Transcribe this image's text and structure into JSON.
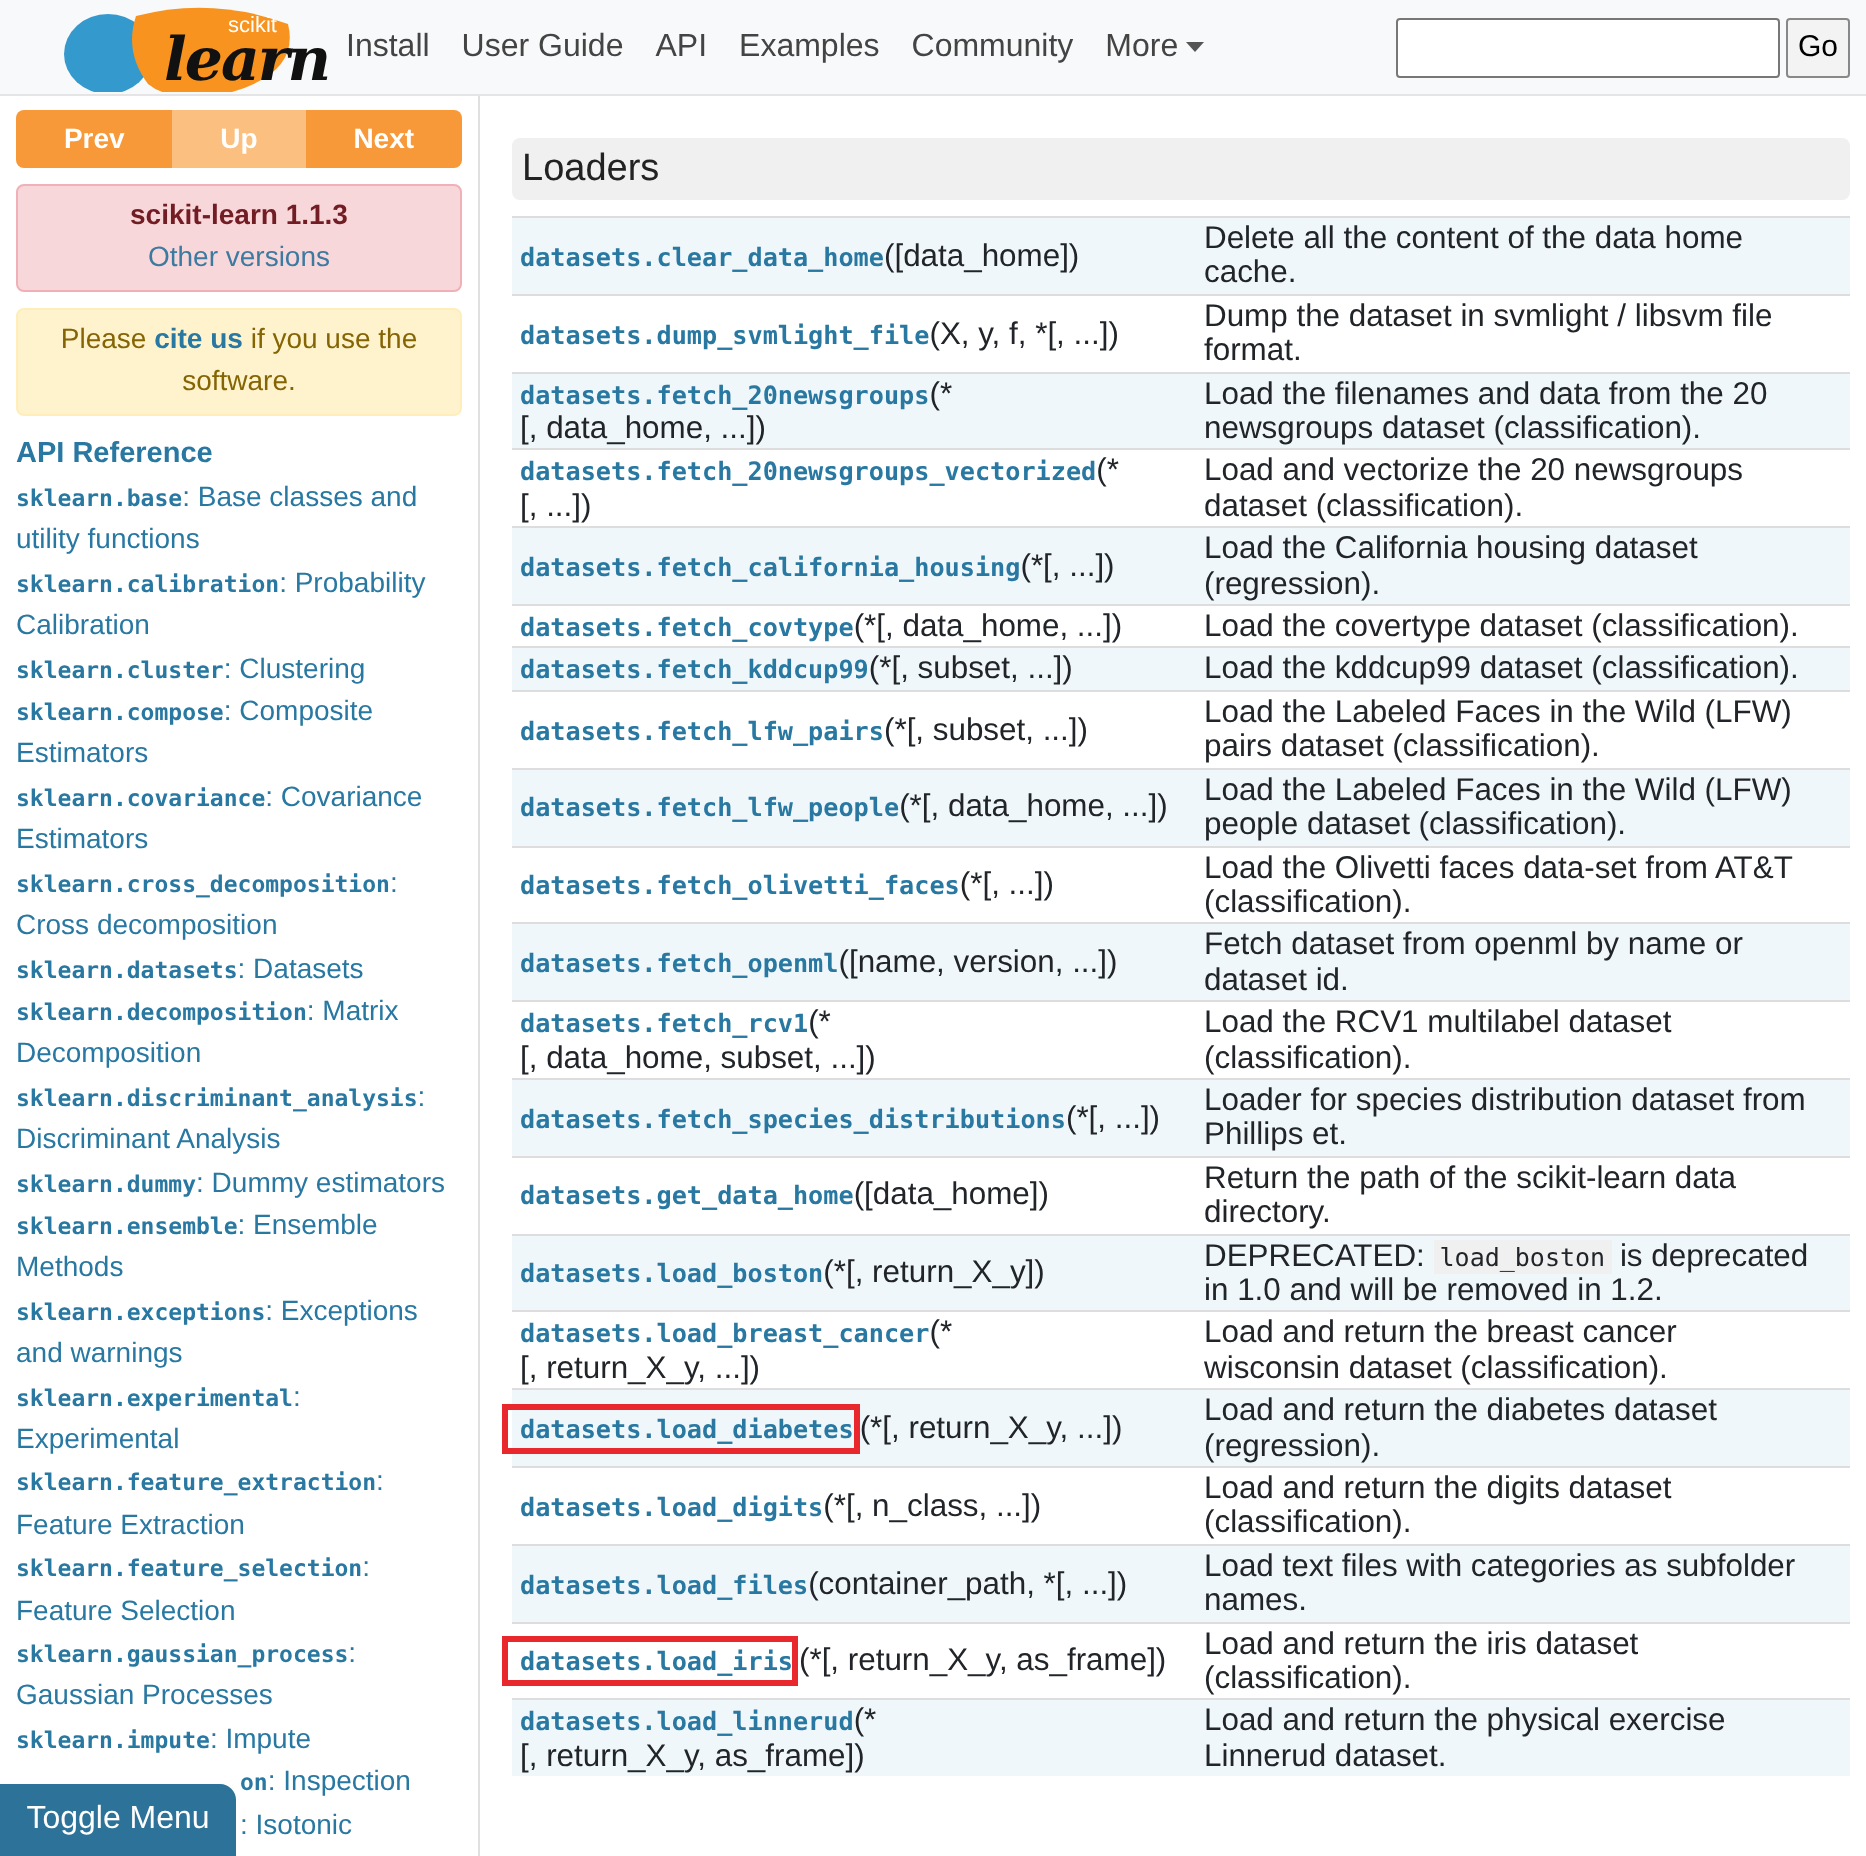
{
  "header": {
    "logo": {
      "small": "scikit",
      "big": "learn"
    },
    "nav": [
      "Install",
      "User Guide",
      "API",
      "Examples",
      "Community"
    ],
    "more": "More",
    "search": {
      "button": "Go"
    }
  },
  "sidebar": {
    "pager": [
      {
        "label": "Prev",
        "kind": "main"
      },
      {
        "label": "Up",
        "kind": "light"
      },
      {
        "label": "Next",
        "kind": "main"
      }
    ],
    "version": {
      "title": "scikit-learn 1.1.3",
      "link": "Other versions"
    },
    "cite": "Please **cite us** if you use the software.",
    "heading": "API Reference",
    "items": [
      {
        "module": "sklearn.base",
        "rest": ": Base classes and utility functions"
      },
      {
        "module": "sklearn.calibration",
        "rest": ": Probability Calibration"
      },
      {
        "module": "sklearn.cluster",
        "rest": ": Clustering"
      },
      {
        "module": "sklearn.compose",
        "rest": ": Composite Estimators"
      },
      {
        "module": "sklearn.covariance",
        "rest": ": Covariance Estimators"
      },
      {
        "module": "sklearn.cross_decomposition",
        "rest": ": Cross decomposition"
      },
      {
        "module": "sklearn.datasets",
        "rest": ": Datasets"
      },
      {
        "module": "sklearn.decomposition",
        "rest": ": Matrix Decomposition"
      },
      {
        "module": "sklearn.discriminant_analysis",
        "rest": ": Discriminant Analysis"
      },
      {
        "module": "sklearn.dummy",
        "rest": ": Dummy estimators"
      },
      {
        "module": "sklearn.ensemble",
        "rest": ": Ensemble Methods"
      },
      {
        "module": "sklearn.exceptions",
        "rest": ": Exceptions and warnings"
      },
      {
        "module": "sklearn.experimental",
        "rest": ": Experimental"
      },
      {
        "module": "sklearn.feature_extraction",
        "rest": ": Feature Extraction"
      },
      {
        "module": "sklearn.feature_selection",
        "rest": ": Feature Selection"
      },
      {
        "module": "sklearn.gaussian_process",
        "rest": ": Gaussian Processes"
      },
      {
        "module": "sklearn.impute",
        "rest": ": Impute"
      },
      {
        "module": "on",
        "rest": ": Inspection",
        "covered": true
      },
      {
        "rest": ": Isotonic",
        "covered": true
      }
    ],
    "toggle": "Toggle Menu"
  },
  "section": {
    "title": "Loaders",
    "rows": [
      {
        "name": "datasets.clear_data_home",
        "sig": "([data_home])",
        "desc": "Delete all the content of the data home cache."
      },
      {
        "name": "datasets.dump_svmlight_file",
        "sig": "(X, y, f, *[, ...])",
        "desc": "Dump the dataset in svmlight / libsvm file format."
      },
      {
        "name": "datasets.fetch_20newsgroups",
        "sig": "(*",
        "sig_cont": "[, data_home, ...])",
        "desc": "Load the filenames and data from the 20 newsgroups dataset (classification)."
      },
      {
        "name": "datasets.fetch_20newsgroups_vectorized",
        "sig": "(*",
        "sig_cont": "[, ...])",
        "desc": "Load and vectorize the 20 newsgroups dataset (classification)."
      },
      {
        "name": "datasets.fetch_california_housing",
        "sig": "(*[, ...])",
        "desc": "Load the California housing dataset (regression)."
      },
      {
        "name": "datasets.fetch_covtype",
        "sig": "(*[, data_home, ...])",
        "desc": "Load the covertype dataset (classification)."
      },
      {
        "name": "datasets.fetch_kddcup99",
        "sig": "(*[, subset, ...])",
        "desc": "Load the kddcup99 dataset (classification)."
      },
      {
        "name": "datasets.fetch_lfw_pairs",
        "sig": "(*[, subset, ...])",
        "desc": "Load the Labeled Faces in the Wild (LFW) pairs dataset (classification)."
      },
      {
        "name": "datasets.fetch_lfw_people",
        "sig": "(*[, data_home, ...])",
        "desc": "Load the Labeled Faces in the Wild (LFW) people dataset (classification)."
      },
      {
        "name": "datasets.fetch_olivetti_faces",
        "sig": "(*[, ...])",
        "desc": "Load the Olivetti faces data-set from AT&T (classification)."
      },
      {
        "name": "datasets.fetch_openml",
        "sig": "([name, version, ...])",
        "desc": "Fetch dataset from openml by name or dataset id."
      },
      {
        "name": "datasets.fetch_rcv1",
        "sig": "(*",
        "sig_cont": "[, data_home, subset, ...])",
        "desc": "Load the RCV1 multilabel dataset (classification)."
      },
      {
        "name": "datasets.fetch_species_distributions",
        "sig": "(*[, ...])",
        "desc": "Loader for species distribution dataset from Phillips et."
      },
      {
        "name": "datasets.get_data_home",
        "sig": "([data_home])",
        "desc": "Return the path of the scikit-learn data directory."
      },
      {
        "name": "datasets.load_boston",
        "sig": "(*[, return_X_y])",
        "desc": [
          {
            "kind": "text",
            "text": "DEPRECATED:"
          },
          {
            "kind": "code",
            "text": "load_boston"
          },
          {
            "kind": "text",
            "text": "is deprecated in 1.0 and will be removed in 1.2."
          }
        ]
      },
      {
        "name": "datasets.load_breast_cancer",
        "sig": "(*",
        "sig_cont": "[, return_X_y, ...])",
        "desc": "Load and return the breast cancer wisconsin dataset (classification)."
      },
      {
        "name": "datasets.load_diabetes",
        "sig": "(*[, return_X_y, ...])",
        "desc": "Load and return the diabetes dataset (regression).",
        "highlighted": true
      },
      {
        "name": "datasets.load_digits",
        "sig": "(*[, n_class, ...])",
        "desc": "Load and return the digits dataset (classification)."
      },
      {
        "name": "datasets.load_files",
        "sig": "(container_path, *[, ...])",
        "desc": "Load text files with categories as subfolder names."
      },
      {
        "name": "datasets.load_iris",
        "sig": "(*[, return_X_y, as_frame])",
        "desc": "Load and return the iris dataset (classification).",
        "highlighted": true
      },
      {
        "name": "datasets.load_linnerud",
        "sig": "(*",
        "sig_cont": "[, return_X_y, as_frame])",
        "desc": "Load and return the physical exercise Linnerud dataset."
      }
    ]
  }
}
